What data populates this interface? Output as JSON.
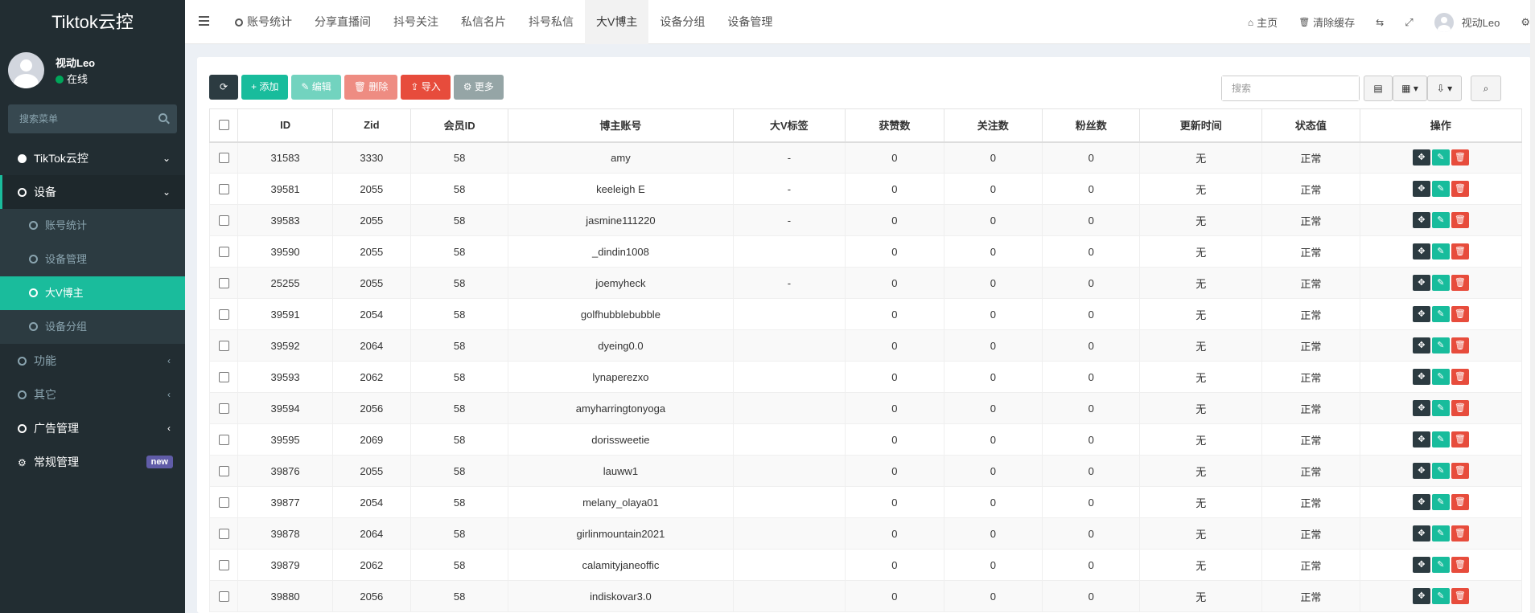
{
  "app": {
    "title": "Tiktok云控"
  },
  "user": {
    "name": "视动Leo",
    "status": "在线"
  },
  "sidebar": {
    "search_placeholder": "搜索菜单",
    "items": [
      {
        "label": "TikTok云控",
        "chev": "⌄"
      },
      {
        "label": "设备",
        "chev": "⌄"
      },
      {
        "label": "账号统计"
      },
      {
        "label": "设备管理"
      },
      {
        "label": "大V博主"
      },
      {
        "label": "设备分组"
      },
      {
        "label": "功能",
        "chev": "‹"
      },
      {
        "label": "其它",
        "chev": "‹"
      },
      {
        "label": "广告管理",
        "chev": "‹"
      },
      {
        "label": "常规管理",
        "badge": "new"
      }
    ]
  },
  "tabs": [
    "账号统计",
    "分享直播间",
    "抖号关注",
    "私信名片",
    "抖号私信",
    "大V博主",
    "设备分组",
    "设备管理"
  ],
  "topright": {
    "home": "主页",
    "clear_cache": "清除缓存",
    "username": "视动Leo"
  },
  "toolbar": {
    "add": "添加",
    "edit": "编辑",
    "delete": "删除",
    "import": "导入",
    "more": "更多"
  },
  "search": {
    "placeholder": "搜索"
  },
  "table": {
    "headers": [
      "ID",
      "Zid",
      "会员ID",
      "博主账号",
      "大V标签",
      "获赞数",
      "关注数",
      "粉丝数",
      "更新时间",
      "状态值",
      "操作"
    ],
    "rows": [
      [
        "31583",
        "3330",
        "58",
        "amy",
        "-",
        "0",
        "0",
        "0",
        "无",
        "正常"
      ],
      [
        "39581",
        "2055",
        "58",
        "keeleigh E",
        "-",
        "0",
        "0",
        "0",
        "无",
        "正常"
      ],
      [
        "39583",
        "2055",
        "58",
        "jasmine111220",
        "-",
        "0",
        "0",
        "0",
        "无",
        "正常"
      ],
      [
        "39590",
        "2055",
        "58",
        "_dindin1008",
        "",
        "0",
        "0",
        "0",
        "无",
        "正常"
      ],
      [
        "25255",
        "2055",
        "58",
        "joemyheck",
        "-",
        "0",
        "0",
        "0",
        "无",
        "正常"
      ],
      [
        "39591",
        "2054",
        "58",
        "golfhubblebubble",
        "",
        "0",
        "0",
        "0",
        "无",
        "正常"
      ],
      [
        "39592",
        "2064",
        "58",
        "dyeing0.0",
        "",
        "0",
        "0",
        "0",
        "无",
        "正常"
      ],
      [
        "39593",
        "2062",
        "58",
        "lynaperezxo",
        "",
        "0",
        "0",
        "0",
        "无",
        "正常"
      ],
      [
        "39594",
        "2056",
        "58",
        "amyharringtonyoga",
        "",
        "0",
        "0",
        "0",
        "无",
        "正常"
      ],
      [
        "39595",
        "2069",
        "58",
        "dorissweetie",
        "",
        "0",
        "0",
        "0",
        "无",
        "正常"
      ],
      [
        "39876",
        "2055",
        "58",
        "lauww1",
        "",
        "0",
        "0",
        "0",
        "无",
        "正常"
      ],
      [
        "39877",
        "2054",
        "58",
        "melany_olaya01",
        "",
        "0",
        "0",
        "0",
        "无",
        "正常"
      ],
      [
        "39878",
        "2064",
        "58",
        "girlinmountain2021",
        "",
        "0",
        "0",
        "0",
        "无",
        "正常"
      ],
      [
        "39879",
        "2062",
        "58",
        "calamityjaneoffic",
        "",
        "0",
        "0",
        "0",
        "无",
        "正常"
      ],
      [
        "39880",
        "2056",
        "58",
        "indiskovar3.0",
        "",
        "0",
        "0",
        "0",
        "无",
        "正常"
      ]
    ]
  },
  "colors": {
    "accent": "#18bc9c",
    "sidebar_bg": "#222d32",
    "danger": "#e74c3c",
    "dark": "#2c3b41"
  }
}
